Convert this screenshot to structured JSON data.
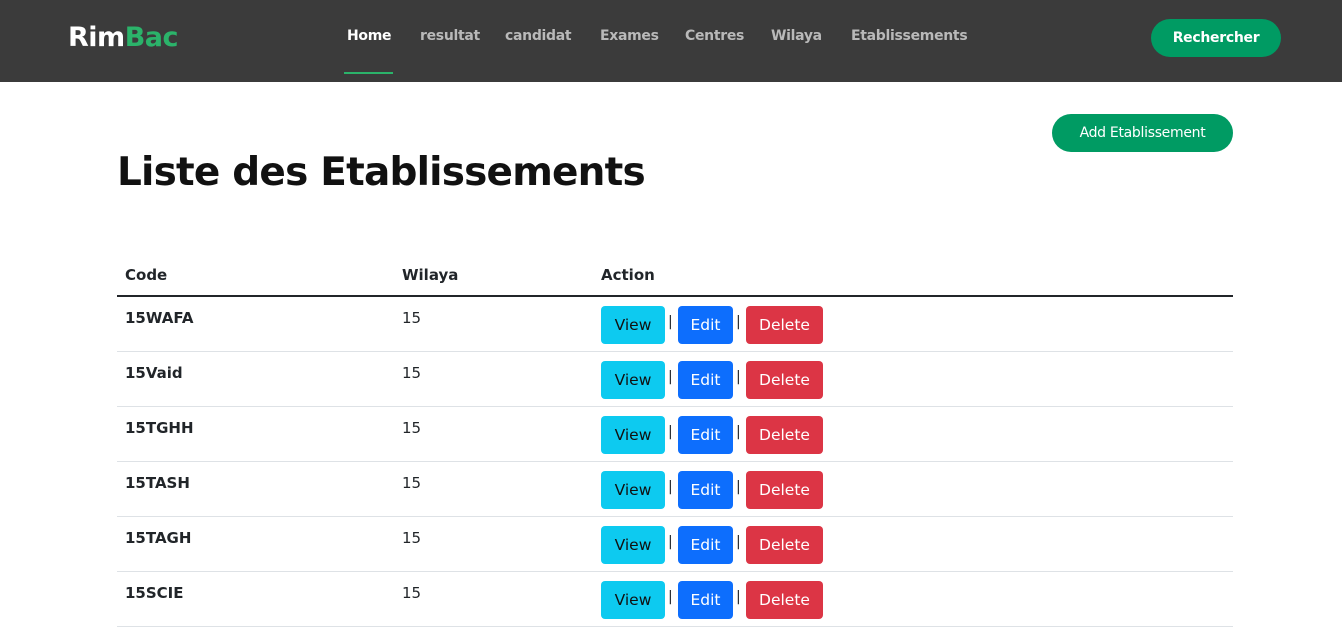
{
  "brand": {
    "part1": "Rim",
    "part2": "Bac"
  },
  "nav": {
    "home": "Home",
    "resultat": "resultat",
    "candidat": "candidat",
    "exames": "Exames",
    "centres": "Centres",
    "wilaya": "Wilaya",
    "etablissements": "Etablissements"
  },
  "header": {
    "search_button": "Rechercher"
  },
  "page": {
    "title": "Liste des Etablissements",
    "add_button": "Add Etablissement"
  },
  "table": {
    "columns": {
      "code": "Code",
      "wilaya": "Wilaya",
      "action": "Action"
    },
    "action_labels": {
      "view": "View",
      "edit": "Edit",
      "delete": "Delete",
      "separator": "|"
    },
    "rows": [
      {
        "code": "15WAFA",
        "wilaya": "15"
      },
      {
        "code": "15Vaid",
        "wilaya": "15"
      },
      {
        "code": "15TGHH",
        "wilaya": "15"
      },
      {
        "code": "15TASH",
        "wilaya": "15"
      },
      {
        "code": "15TAGH",
        "wilaya": "15"
      },
      {
        "code": "15SCIE",
        "wilaya": "15"
      }
    ]
  },
  "colors": {
    "navbar": "#3b3b3b",
    "accent_green": "#009b63",
    "brand_green": "#2bb36a",
    "view": "#0dcaf0",
    "edit": "#0d6efd",
    "delete": "#dc3545"
  }
}
